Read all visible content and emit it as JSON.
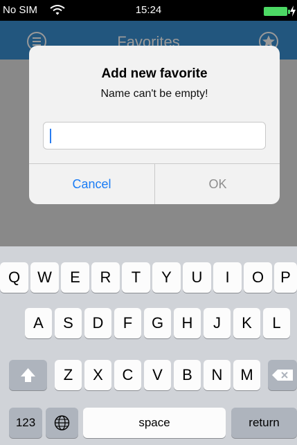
{
  "status_bar": {
    "carrier": "No SIM",
    "time": "15:24"
  },
  "nav_bar": {
    "title": "Favorites"
  },
  "alert": {
    "title": "Add new favorite",
    "message": "Name can't be empty!",
    "input_value": "",
    "cancel_label": "Cancel",
    "ok_label": "OK"
  },
  "keyboard": {
    "row1": [
      "Q",
      "W",
      "E",
      "R",
      "T",
      "Y",
      "U",
      "I",
      "O",
      "P"
    ],
    "row2": [
      "A",
      "S",
      "D",
      "F",
      "G",
      "H",
      "J",
      "K",
      "L"
    ],
    "row3": [
      "Z",
      "X",
      "C",
      "V",
      "B",
      "N",
      "M"
    ],
    "numbers_label": "123",
    "space_label": "space",
    "return_label": "return"
  },
  "colors": {
    "nav_blue": "#3a8fd3",
    "button_blue": "#1a7cf5",
    "battery_green": "#4cd964"
  },
  "icons": [
    "wifi-icon",
    "battery-icon",
    "charge-icon",
    "menu-icon",
    "star-icon",
    "shift-icon",
    "delete-icon",
    "globe-icon"
  ]
}
